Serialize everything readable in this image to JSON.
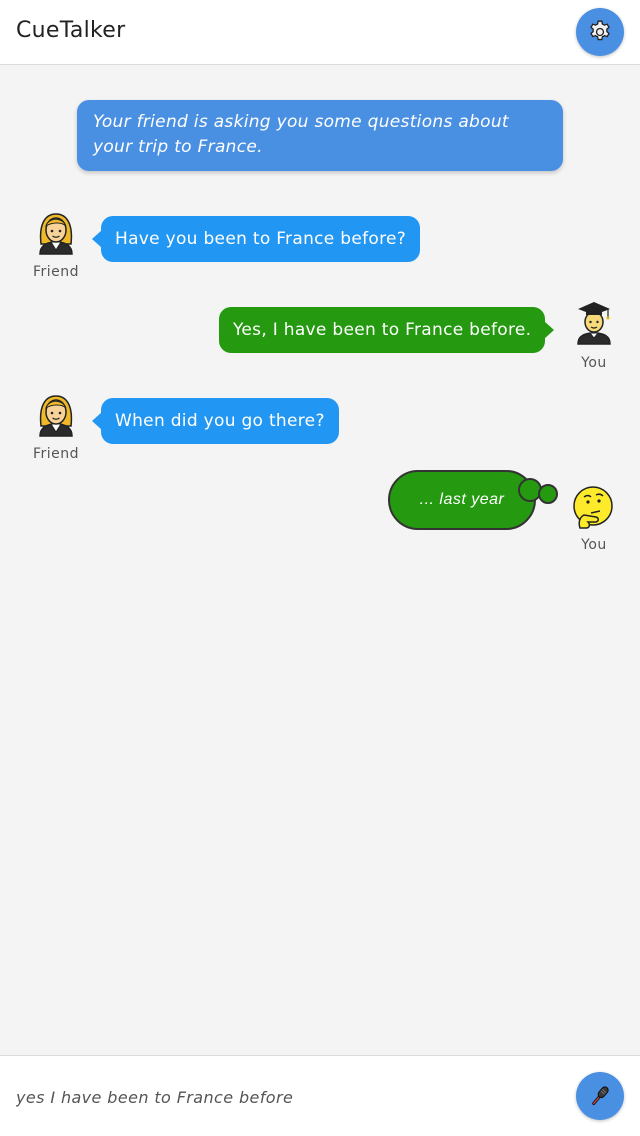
{
  "header": {
    "title": "CueTalker",
    "settings_icon": "gear-icon"
  },
  "prompt": {
    "text": "Your friend is asking you some questions about your trip to France."
  },
  "messages": [
    {
      "speaker": "friend",
      "label": "Friend",
      "avatar": "woman-icon",
      "text": "Have you been to France before?"
    },
    {
      "speaker": "you",
      "label": "You",
      "avatar": "graduate-icon",
      "text": "Yes, I have been to France before."
    },
    {
      "speaker": "friend",
      "label": "Friend",
      "avatar": "woman-icon",
      "text": "When did you go there?"
    },
    {
      "speaker": "you",
      "label": "You",
      "avatar": "thinking-face-icon",
      "text": "... last year",
      "style": "thought"
    }
  ],
  "input": {
    "value": "yes I have been to France before",
    "mic_icon": "microphone-icon"
  },
  "colors": {
    "header_bg": "#ffffff",
    "accent_blue": "#4a90e2",
    "friend_bubble": "#2196f3",
    "you_bubble": "#259a11",
    "background": "#f4f4f4"
  }
}
